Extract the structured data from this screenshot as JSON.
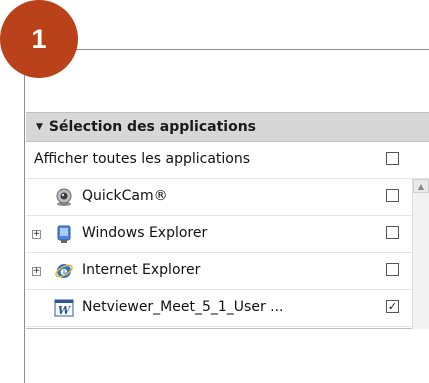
{
  "step_badge": "1",
  "panel": {
    "title": "Sélection des applications",
    "rows": [
      {
        "label": "Afficher toutes les applications",
        "checked": false
      },
      {
        "label": "QuickCam®",
        "checked": false,
        "icon": "webcam-icon"
      },
      {
        "label": "Windows Explorer",
        "checked": false,
        "icon": "windows-explorer-icon",
        "expandable": true
      },
      {
        "label": "Internet Explorer",
        "checked": false,
        "icon": "internet-explorer-icon",
        "expandable": true
      },
      {
        "label": "Netviewer_Meet_5_1_User ...",
        "checked": true,
        "icon": "word-document-icon"
      }
    ]
  },
  "colors": {
    "badge": "#b9421b",
    "header": "#d7d7d7"
  }
}
